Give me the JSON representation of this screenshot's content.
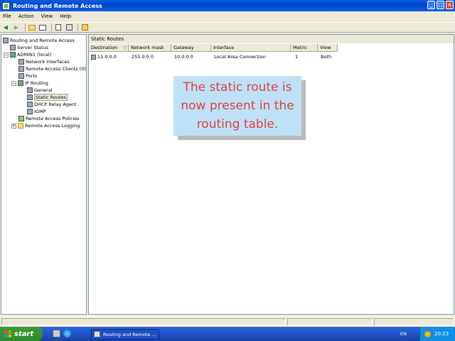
{
  "window": {
    "title": "Routing and Remote Access"
  },
  "menu": [
    "File",
    "Action",
    "View",
    "Help"
  ],
  "toolbar_icons": [
    "back-icon",
    "forward-icon",
    "up-folder-icon",
    "show-hide-tree-icon",
    "export-icon",
    "properties-icon",
    "help-icon"
  ],
  "tree": {
    "root": "Routing and Remote Access",
    "server_status": "Server Status",
    "server": "ADMIN1 (local)",
    "network_interfaces": "Network Interfaces",
    "remote_access_clients": "Remote Access Clients (0)",
    "ports": "Ports",
    "ip_routing": "IP Routing",
    "general": "General",
    "static_routes": "Static Routes",
    "dhcp_relay": "DHCP Relay Agent",
    "igmp": "IGMP",
    "remote_access_policies": "Remote Access Policies",
    "remote_access_logging": "Remote Access Logging"
  },
  "right_pane": {
    "header": "Static Routes",
    "columns": [
      "Destination",
      "Network mask",
      "Gateway",
      "Interface",
      "Metric",
      "View"
    ],
    "sort_indicator": "▽",
    "row": {
      "destination": "11.0.0.0",
      "mask": "255.0.0.0",
      "gateway": "10.0.0.0",
      "interface": "Local Area Connection",
      "metric": "1",
      "view": "Both"
    }
  },
  "callout": {
    "text": "The static route is now present in the routing table."
  },
  "taskbar": {
    "start": "start",
    "task_label": "Routing and Remote ...",
    "language": "EN",
    "clock": "20:23"
  }
}
